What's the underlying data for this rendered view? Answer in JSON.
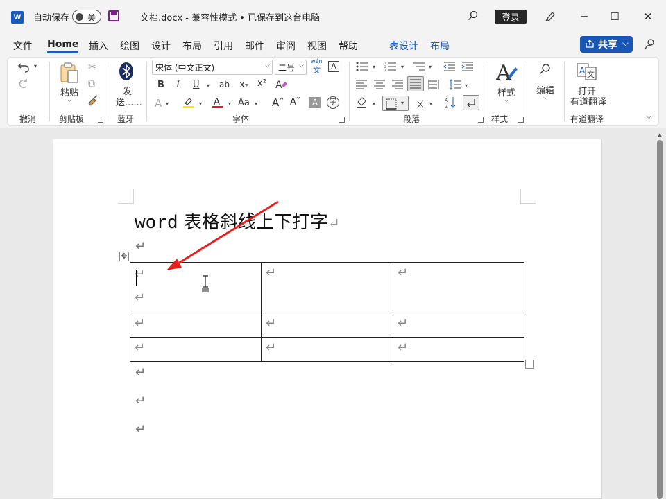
{
  "titlebar": {
    "app_icon": "W",
    "autosave_label": "自动保存",
    "autosave_state": "关",
    "doc_title": "文档.docx  -  兼容性模式 • 已保存到这台电脑",
    "login_label": "登录",
    "minimize": "─",
    "maximize": "☐",
    "close": "✕"
  },
  "tabs": [
    "文件",
    "Home",
    "插入",
    "绘图",
    "设计",
    "布局",
    "引用",
    "邮件",
    "审阅",
    "视图",
    "帮助",
    "表设计",
    "布局"
  ],
  "share": {
    "label": "共享",
    "chevron": "⌵"
  },
  "ribbon": {
    "groups": {
      "undo": "撤消",
      "clipboard": "剪贴板",
      "bluetooth": "蓝牙",
      "font": "字体",
      "paragraph": "段落",
      "styles": "样式",
      "youdao": "有道翻译"
    },
    "paste_label": "粘贴",
    "send_label_1": "发",
    "send_label_2": "送......",
    "font_name": "宋体 (中文正文)",
    "font_size": "二号",
    "wen_small": "wén",
    "wen_big": "文",
    "font_buttons": [
      "B",
      "I",
      "U",
      "ab",
      "x₂",
      "x²"
    ],
    "styles_label": "样式",
    "edit_label": "编辑",
    "open_label": "打开",
    "youdao_label": "有道翻译"
  },
  "document": {
    "heading_latin": "word",
    "heading_cjk": " 表格斜线上下打字",
    "para_mark": "↵",
    "table": {
      "rows": [
        [
          "↵\n↵",
          "↵",
          "↵"
        ],
        [
          "↵",
          "↵",
          "↵"
        ],
        [
          "↵",
          "↵",
          "↵"
        ]
      ]
    }
  },
  "colors": {
    "accent": "#185abd",
    "annotation_arrow": "#e8201c",
    "highlight_yellow": "#ffe800",
    "font_red": "#e81c1c"
  }
}
